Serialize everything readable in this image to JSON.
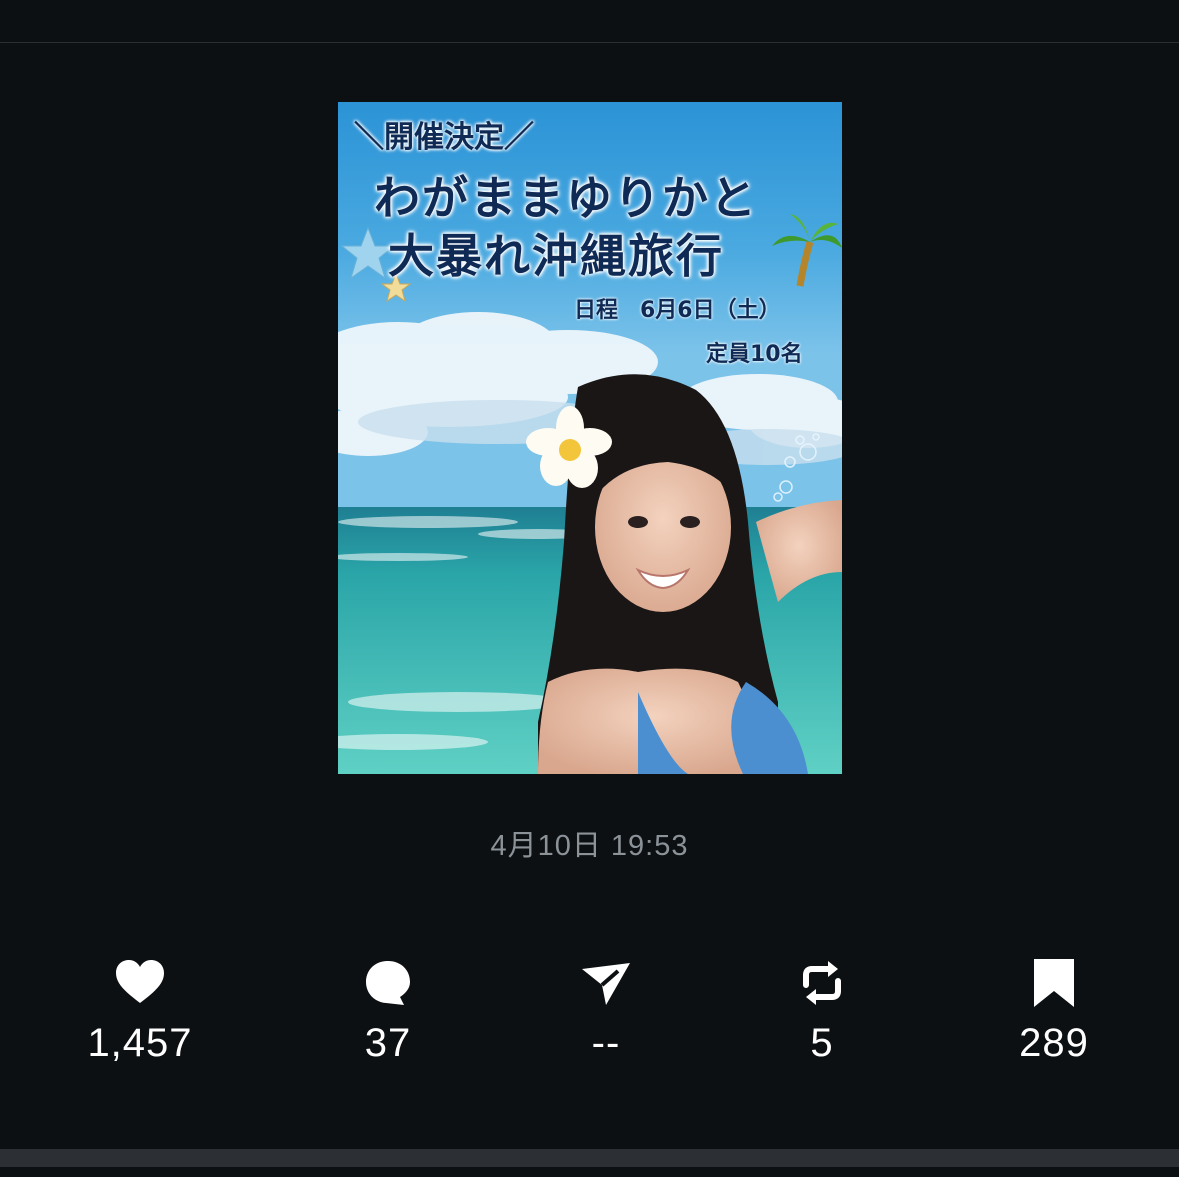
{
  "poster": {
    "tag": "＼開催決定／",
    "title_line1": "わがままゆりかと",
    "title_line2": "大暴れ沖縄旅行",
    "schedule": "日程　6月6日（土）",
    "capacity": "定員10名"
  },
  "post": {
    "timestamp": "4月10日 19:53"
  },
  "actions": [
    {
      "name": "like",
      "icon": "heart-icon",
      "count": "1,457"
    },
    {
      "name": "reply",
      "icon": "speech-bubble-icon",
      "count": "37"
    },
    {
      "name": "share",
      "icon": "paper-plane-icon",
      "count": "--"
    },
    {
      "name": "repost",
      "icon": "repost-arrows-icon",
      "count": "5"
    },
    {
      "name": "bookmark",
      "icon": "bookmark-icon",
      "count": "289"
    }
  ],
  "colors": {
    "background": "#0c1013",
    "text": "#ffffff",
    "muted": "#8b9298"
  }
}
